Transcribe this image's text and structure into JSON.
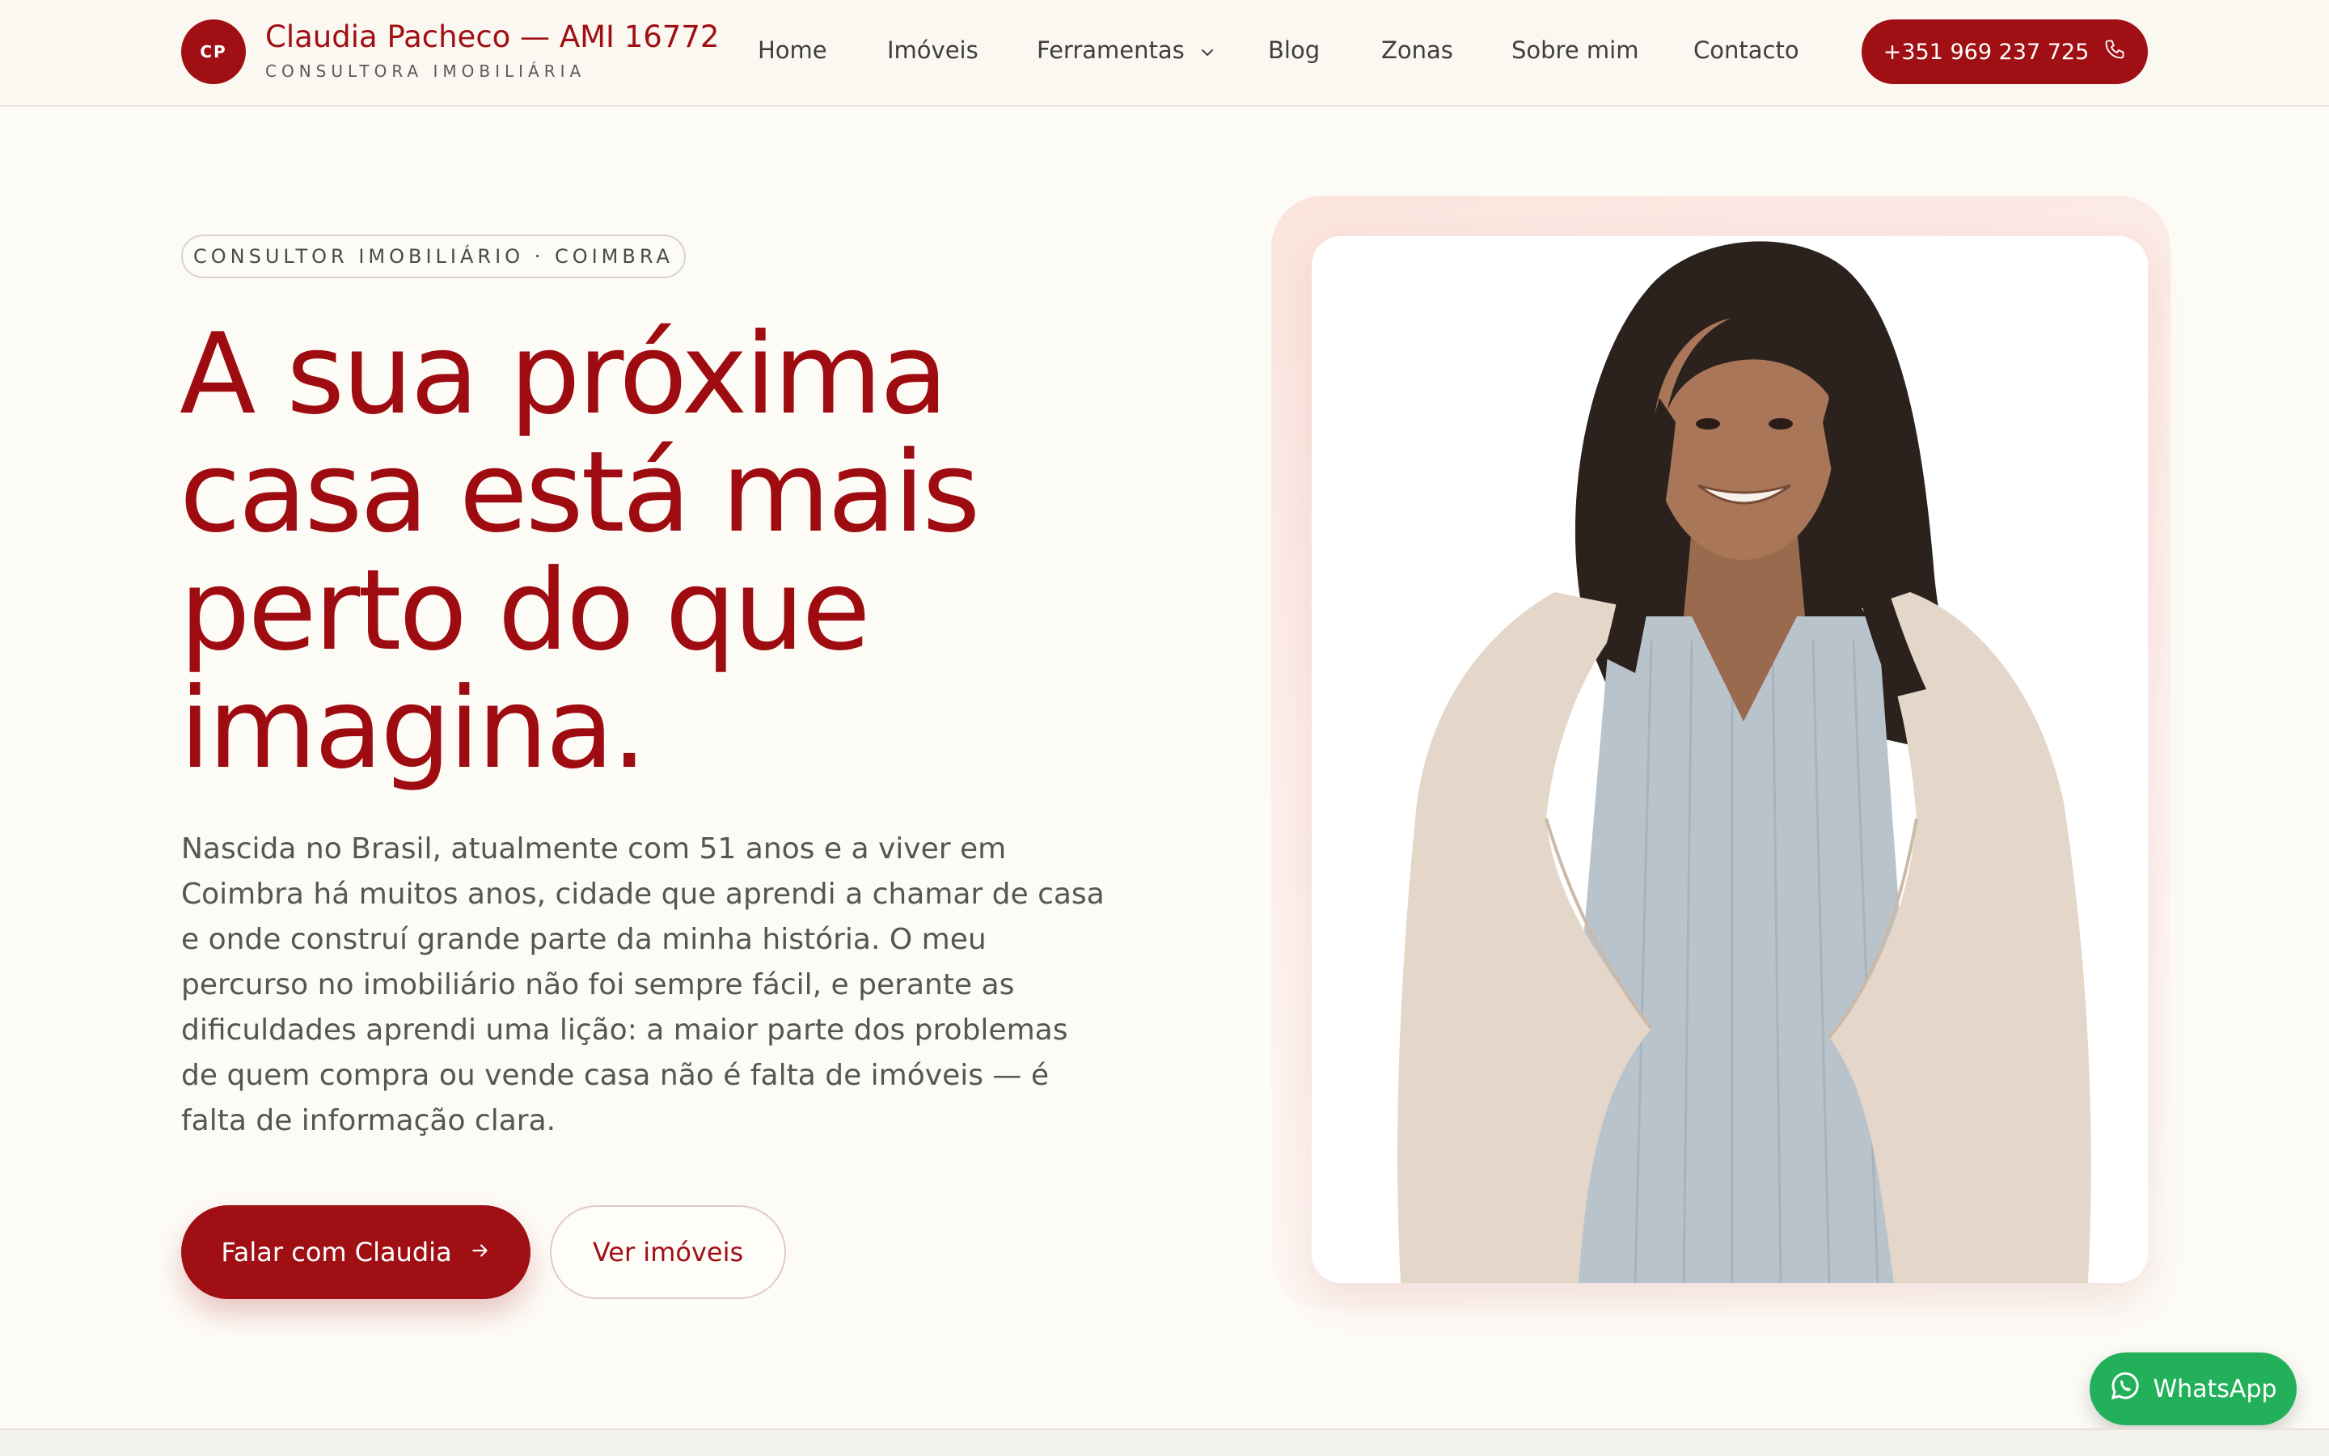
{
  "header": {
    "logo_initials": "CP",
    "brand_name": "Claudia Pacheco — AMI 16772",
    "brand_subtitle": "CONSULTORA IMOBILIÁRIA",
    "nav": [
      {
        "label": "Home"
      },
      {
        "label": "Imóveis"
      },
      {
        "label": "Ferramentas",
        "icon": "chevron-down-icon"
      },
      {
        "label": "Blog"
      },
      {
        "label": "Zonas"
      },
      {
        "label": "Sobre mim"
      },
      {
        "label": "Contacto"
      }
    ],
    "phone_label": "+351 969 237 725",
    "phone_icon": "phone-icon"
  },
  "hero": {
    "eyebrow": "CONSULTOR IMOBILIÁRIO · COIMBRA",
    "headline_lines": [
      "A sua próxima",
      "casa está mais",
      "perto do que",
      "imagina."
    ],
    "lead_lines": [
      "Nascida no Brasil, atualmente com 51 anos e a viver em",
      "Coimbra há muitos anos, cidade que aprendi a chamar de casa",
      "e onde construí grande parte da minha história. O meu",
      "percurso no imobiliário não foi sempre fácil, e perante as",
      "dificuldades aprendi uma lição: a maior parte dos problemas",
      "de quem compra ou vende casa não é falta de imóveis — é",
      "falta de informação clara."
    ],
    "cta_primary": "Falar com Claudia",
    "cta_primary_icon": "arrow-right-icon",
    "cta_secondary": "Ver imóveis",
    "photo_alt": "Claudia Pacheco"
  },
  "whatsapp": {
    "label": "WhatsApp",
    "icon": "whatsapp-icon"
  },
  "colors": {
    "brand": "#a00f14",
    "background": "#fdfbf6",
    "whatsapp": "#22b05a"
  }
}
